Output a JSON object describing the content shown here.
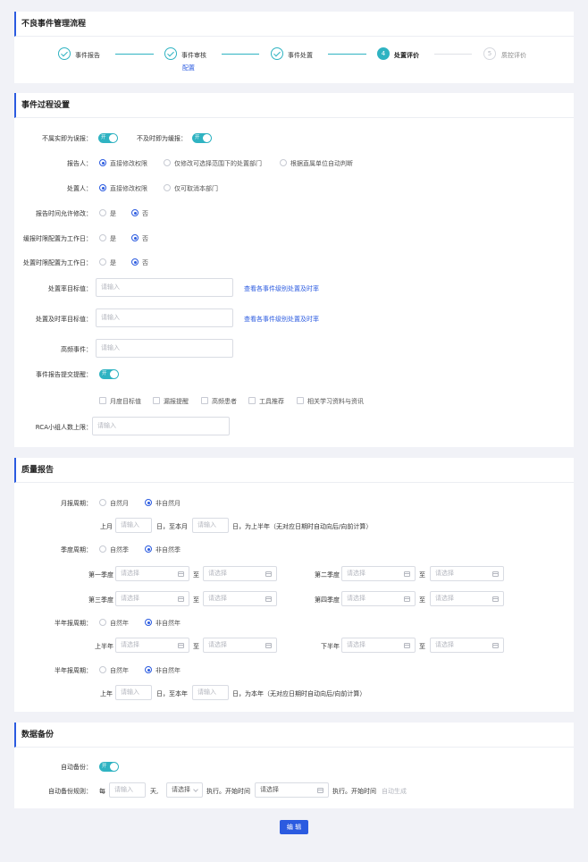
{
  "flow": {
    "title": "不良事件管理流程",
    "steps": [
      {
        "num": "1",
        "label": "事件报告"
      },
      {
        "num": "2",
        "label": "事件审核",
        "sub": "配置"
      },
      {
        "num": "3",
        "label": "事件处置"
      },
      {
        "num": "4",
        "label": "处置评价"
      },
      {
        "num": "5",
        "label": "质控评价"
      }
    ]
  },
  "process": {
    "title": "事件过程设置",
    "not_real_label": "不属实即为误报：",
    "late_label": "不及时即为缓报：",
    "toggle_on": "开",
    "reporter": {
      "label": "报告人：",
      "options": [
        "直接修改权限",
        "仅修改可选择范围下的处置部门",
        "根据直属单位自动判断"
      ]
    },
    "handler": {
      "label": "处置人：",
      "options": [
        "直接修改权限",
        "仅可取消本部门"
      ]
    },
    "report_time": {
      "label": "报告时间允许修改："
    },
    "late_workday": {
      "label": "缓报时限配置为工作日："
    },
    "handle_workday": {
      "label": "处置时限配置为工作日："
    },
    "yes": "是",
    "no": "否",
    "rate_target": {
      "label": "处置率目标值：",
      "placeholder": "请输入",
      "link": "查看各事件级别处置及时率"
    },
    "timely_target": {
      "label": "处置及时率目标值：",
      "placeholder": "请输入",
      "link": "查看各事件级别处置及时率"
    },
    "frequent": {
      "label": "高频事件：",
      "placeholder": "请输入"
    },
    "remind": {
      "label": "事件报告提交提醒："
    },
    "checks": [
      "月度目标值",
      "漏报提醒",
      "高频患者",
      "工具推荐",
      "相关学习资料与资讯"
    ],
    "rca": {
      "label": "RCA小组人数上限：",
      "placeholder": "请输入"
    }
  },
  "quality": {
    "title": "质量报告",
    "month": {
      "label": "月报周期：",
      "options": [
        "自然月",
        "非自然月"
      ]
    },
    "month_row": {
      "prev": "上月",
      "placeholder": "请输入",
      "mid": "日，至本月",
      "tail": "日，为上半年（无对应日期时自动向后/向前计算）"
    },
    "quarter": {
      "label": "季度周期：",
      "options": [
        "自然季",
        "非自然季"
      ]
    },
    "q1": "第一季度",
    "q2": "第二季度",
    "q3": "第三季度",
    "q4": "第四季度",
    "select_ph": "请选择",
    "to": "至",
    "half": {
      "label": "半年报周期：",
      "options": [
        "自然年",
        "非自然年"
      ]
    },
    "h1": "上半年",
    "h2": "下半年",
    "half2": {
      "label": "半年报周期：",
      "options": [
        "自然年",
        "非自然年"
      ]
    },
    "year_row": {
      "prev": "上年",
      "placeholder": "请输入",
      "mid": "日，至本年",
      "tail": "日，为本年（无对应日期时自动向后/向前计算）"
    }
  },
  "backup": {
    "title": "数据备份",
    "auto_label": "自动备份：",
    "rule_label": "自动备份规则：",
    "every": "每",
    "days_ph": "请输入",
    "days": "天,",
    "sel_ph": "请选择",
    "exec": "执行。开始时间",
    "time_ph": "请选择",
    "exec2": "执行。开始时间",
    "auto_gen": "自动生成"
  },
  "footer": {
    "edit": "编 辑"
  },
  "colors": {
    "primary": "#2b5be0",
    "teal": "#2fb3c2",
    "bg": "#f1f2f7"
  }
}
